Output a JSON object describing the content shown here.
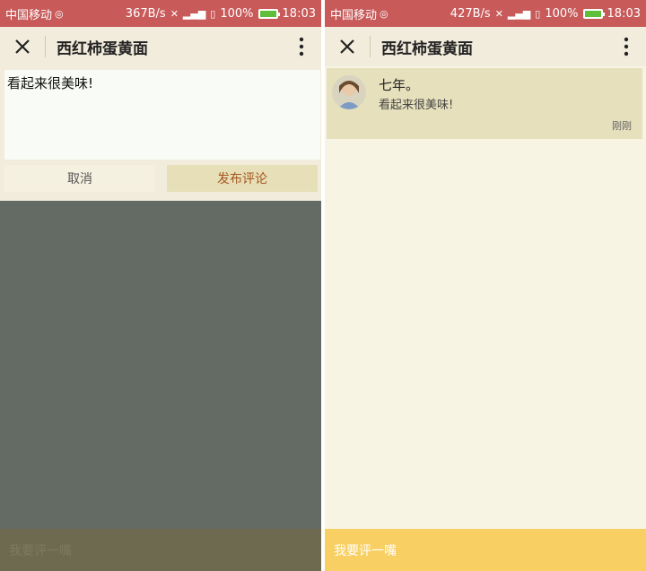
{
  "colors": {
    "status_bar": "#c85a5a",
    "title_bar": "#f2ecdc",
    "page_bg": "#f7f4e4",
    "overlay": "#646a64",
    "accent_button": "#f8cf62",
    "publish_text": "#a5561f",
    "card_bg": "#e6e0bc"
  },
  "left": {
    "status": {
      "carrier": "中国移动",
      "speed": "367B/s",
      "battery": "100%",
      "time": "18:03"
    },
    "header": {
      "title": "西红柿蛋黄面"
    },
    "editor": {
      "value": "看起来很美味!",
      "cancel_label": "取消",
      "publish_label": "发布评论"
    },
    "bottom_label": "我要评一嘴"
  },
  "right": {
    "status": {
      "carrier": "中国移动",
      "speed": "427B/s",
      "battery": "100%",
      "time": "18:03"
    },
    "header": {
      "title": "西红柿蛋黄面"
    },
    "comments": [
      {
        "user": "七年。",
        "text": "看起来很美味!",
        "time": "刚刚"
      }
    ],
    "bottom_label": "我要评一嘴"
  }
}
